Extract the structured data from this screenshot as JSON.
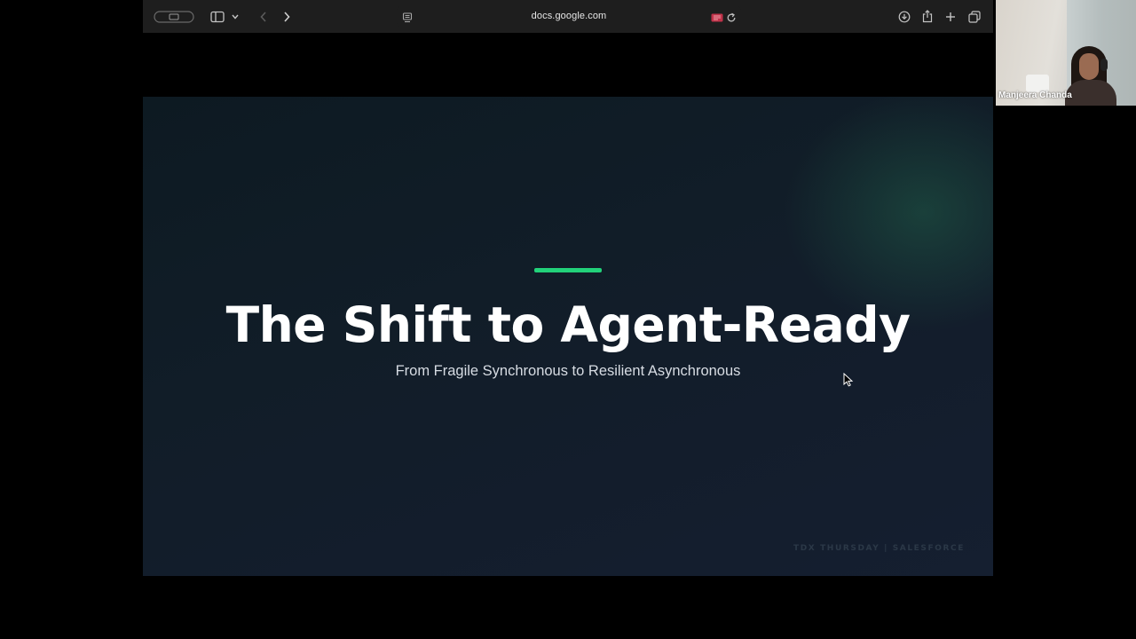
{
  "browser": {
    "url": "docs.google.com"
  },
  "slide": {
    "title": "The Shift to Agent-Ready",
    "subtitle": "From Fragile Synchronous to Resilient Asynchronous",
    "footer": "TDX THURSDAY | SALESFORCE"
  },
  "participant": {
    "name": "Manjeera Chanda"
  },
  "colors": {
    "accent": "#22d27a",
    "toolbar": "#1e1e1e",
    "slide_bg": "#111d28"
  },
  "icons": [
    "window-control-icon",
    "sidebar-icon",
    "chevron-down-icon",
    "back-arrow-icon",
    "forward-arrow-icon",
    "page-settings-icon",
    "screen-recording-icon",
    "reload-icon",
    "download-icon",
    "share-icon",
    "new-tab-icon",
    "tab-overview-icon",
    "mouse-pointer-icon"
  ]
}
